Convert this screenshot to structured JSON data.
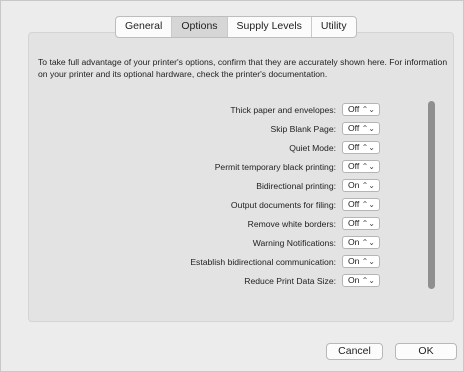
{
  "tabs": [
    {
      "label": "General",
      "selected": false
    },
    {
      "label": "Options",
      "selected": true
    },
    {
      "label": "Supply Levels",
      "selected": false
    },
    {
      "label": "Utility",
      "selected": false
    }
  ],
  "intro_text": "To take full advantage of your printer's options, confirm that they are accurately shown here. For information on your printer and its optional hardware, check the printer's documentation.",
  "options": [
    {
      "label": "Thick paper and envelopes:",
      "value": "Off"
    },
    {
      "label": "Skip Blank Page:",
      "value": "Off"
    },
    {
      "label": "Quiet Mode:",
      "value": "Off"
    },
    {
      "label": "Permit temporary black printing:",
      "value": "Off"
    },
    {
      "label": "Bidirectional printing:",
      "value": "On"
    },
    {
      "label": "Output documents for filing:",
      "value": "Off"
    },
    {
      "label": "Remove white borders:",
      "value": "Off"
    },
    {
      "label": "Warning Notifications:",
      "value": "On"
    },
    {
      "label": "Establish bidirectional communication:",
      "value": "On"
    },
    {
      "label": "Reduce Print Data Size:",
      "value": "On"
    }
  ],
  "popup_arrows": "⌃⌄",
  "buttons": {
    "cancel": "Cancel",
    "ok": "OK"
  },
  "colors": {
    "panel": "#e3e3e3",
    "scroll_thumb": "#8f8f8f"
  }
}
